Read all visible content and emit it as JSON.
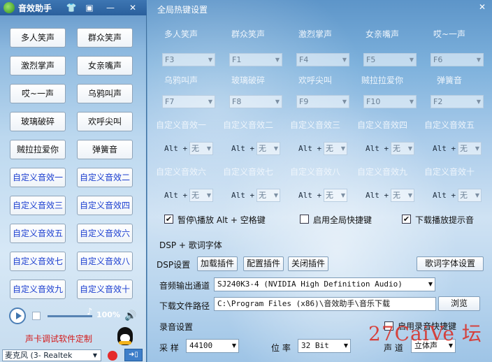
{
  "left": {
    "title": "音效助手",
    "buttons": [
      "多人笑声",
      "群众笑声",
      "激烈掌声",
      "女亲嘴声",
      "哎~一声",
      "乌鸦叫声",
      "玻璃破碎",
      "欢呼尖叫",
      "贼拉拉爱你",
      "弹簧音"
    ],
    "custom": [
      "自定义音效一",
      "自定义音效二",
      "自定义音效三",
      "自定义音效四",
      "自定义音效五",
      "自定义音效六",
      "自定义音效七",
      "自定义音效八",
      "自定义音效九",
      "自定义音效十"
    ],
    "volume": "100%",
    "volume_level": 1.0,
    "sc_link": "声卡调试软件定制",
    "mic": "麦克风 (3- Realtek"
  },
  "right": {
    "title": "全局热键设置",
    "hotkeys": [
      {
        "label": "多人笑声",
        "key": "F3"
      },
      {
        "label": "群众笑声",
        "key": "F1"
      },
      {
        "label": "激烈掌声",
        "key": "F4"
      },
      {
        "label": "女亲嘴声",
        "key": "F5"
      },
      {
        "label": "哎~一声",
        "key": "F6"
      },
      {
        "label": "乌鸦叫声",
        "key": "F7"
      },
      {
        "label": "玻璃破碎",
        "key": "F8"
      },
      {
        "label": "欢呼尖叫",
        "key": "F9"
      },
      {
        "label": "贼拉拉爱你",
        "key": "F10"
      },
      {
        "label": "弹簧音",
        "key": "F2"
      }
    ],
    "custom_hotkeys": [
      {
        "label": "自定义音效一",
        "key": "无"
      },
      {
        "label": "自定义音效二",
        "key": "无"
      },
      {
        "label": "自定义音效三",
        "key": "无"
      },
      {
        "label": "自定义音效四",
        "key": "无"
      },
      {
        "label": "自定义音效五",
        "key": "无"
      },
      {
        "label": "自定义音效六",
        "key": "无"
      },
      {
        "label": "自定义音效七",
        "key": "无"
      },
      {
        "label": "自定义音效八",
        "key": "无"
      },
      {
        "label": "自定义音效九",
        "key": "无"
      },
      {
        "label": "自定义音效十",
        "key": "无"
      }
    ],
    "alt_label": "Alt +",
    "checkboxes": {
      "pause": {
        "label": "暂停\\播放 Alt + 空格键",
        "checked": true
      },
      "global": {
        "label": "启用全局快捷键",
        "checked": false
      },
      "tone": {
        "label": "下载播放提示音",
        "checked": true
      }
    },
    "dsp_title": "DSP  +  歌词字体",
    "dsp_settings": "DSP设置",
    "btn_load": "加载插件",
    "btn_config": "配置插件",
    "btn_close": "关闭插件",
    "btn_lyric": "歌词字体设置",
    "audio_out_label": "音频输出通道",
    "audio_out_value": "SJ240K3-4 (NVIDIA High Definition Audio)",
    "download_label": "下载文件路径",
    "download_value": "C:\\Program Files (x86)\\音效助手\\音乐下载",
    "browse": "浏览",
    "rec_title": "录音设置",
    "rec_hotkey": {
      "label": "启用录音快捷键",
      "checked": false
    },
    "sample_label": "采  样",
    "sample_value": "44100",
    "bit_label": "位  率",
    "bit_value": "32 Bit",
    "channel_label": "声  道",
    "channel_value": "立体声"
  },
  "watermark": "27CaiVe 坛"
}
